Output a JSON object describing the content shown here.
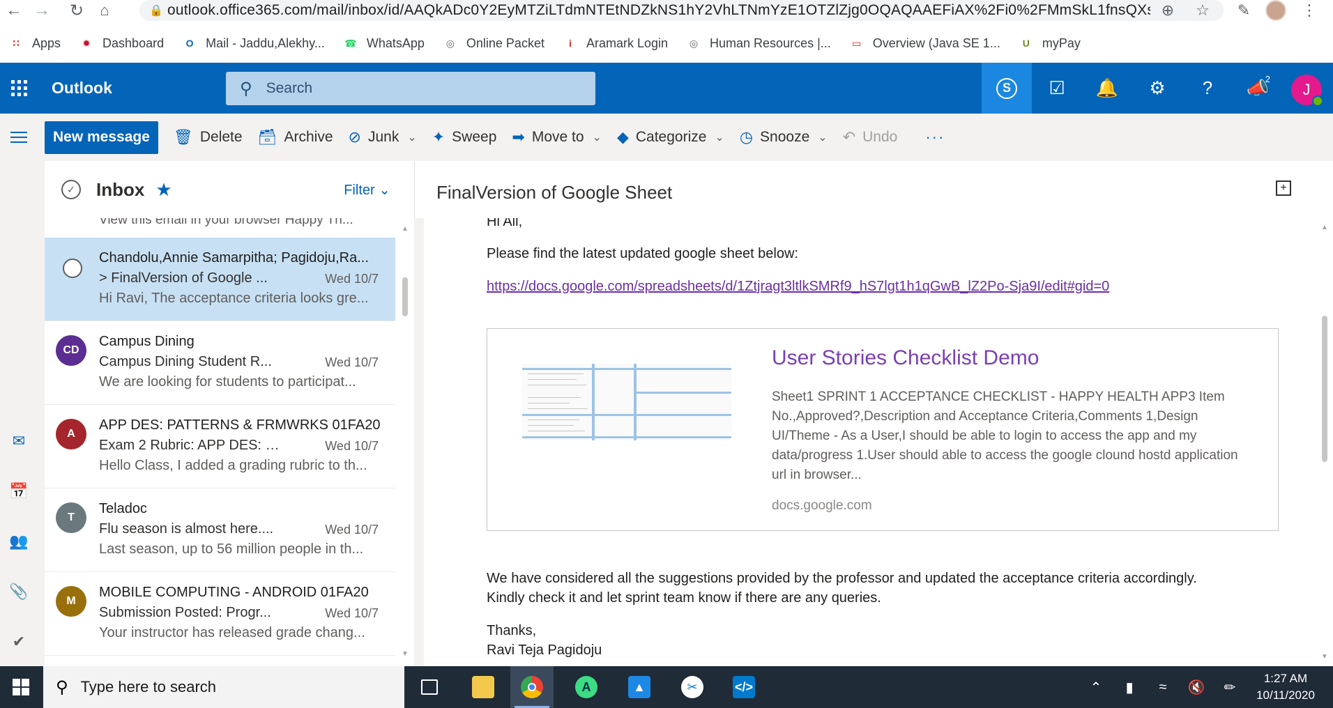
{
  "browser": {
    "url": "outlook.office365.com/mail/inbox/id/AAQkADc0Y2EyMTZiLTdmNTEtNDZkNS1hY2VhLTNmYzE1OTZlZjg0OQAQAAEFiAX%2Fi0%2FMmSkL1fnsQXs%3...",
    "bookmarks": [
      {
        "label": "Apps",
        "icon": "apps-grid-icon",
        "color": "#ea4335"
      },
      {
        "label": "Dashboard",
        "icon": "dashboard-icon",
        "color": "#c8102e"
      },
      {
        "label": "Mail - Jaddu,Alekhy...",
        "icon": "outlook-icon",
        "color": "#0364b8"
      },
      {
        "label": "WhatsApp",
        "icon": "whatsapp-icon",
        "color": "#25d366"
      },
      {
        "label": "Online Packet",
        "icon": "globe-icon",
        "color": "#5f6368"
      },
      {
        "label": "Aramark Login",
        "icon": "aramark-icon",
        "color": "#d52b1e"
      },
      {
        "label": "Human Resources |...",
        "icon": "globe-icon",
        "color": "#5f6368"
      },
      {
        "label": "Overview (Java SE 1...",
        "icon": "oracle-icon",
        "color": "#e5161b"
      },
      {
        "label": "myPay",
        "icon": "mypay-icon",
        "color": "#6f8d23"
      }
    ]
  },
  "outlook": {
    "brand": "Outlook",
    "search_placeholder": "Search",
    "new_message": "New message",
    "commands": {
      "delete": "Delete",
      "archive": "Archive",
      "junk": "Junk",
      "sweep": "Sweep",
      "move_to": "Move to",
      "categorize": "Categorize",
      "snooze": "Snooze",
      "undo": "Undo"
    },
    "header_icons": [
      "skype-icon",
      "todo-icon",
      "bell-icon",
      "gear-icon",
      "help-icon",
      "megaphone-icon"
    ],
    "megaphone_count": "2",
    "user_initial": "J",
    "accent": "#0364b8",
    "avatar_color": "#e3198d"
  },
  "inbox": {
    "title": "Inbox",
    "filter": "Filter",
    "truncated_preview": "View this email in your browser Happy Th...",
    "messages": [
      {
        "sender": "Chandolu,Annie Samarpitha; Pagidoju,Ra...",
        "subject": "> FinalVersion of Google ...",
        "date": "Wed 10/7",
        "preview": "Hi Ravi, The acceptance criteria looks gre...",
        "initials": "",
        "color": "#c7e0f4"
      },
      {
        "sender": "Campus Dining",
        "subject": "Campus Dining Student R...",
        "date": "Wed 10/7",
        "preview": "We are looking for students to participat...",
        "initials": "CD",
        "color": "#5c2e91"
      },
      {
        "sender": "APP DES: PATTERNS & FRMWRKS 01FA20",
        "subject": "Exam 2 Rubric: APP DES: P...",
        "date": "Wed 10/7",
        "preview": "Hello Class, I added a grading rubric to th...",
        "initials": "A",
        "color": "#a4262c"
      },
      {
        "sender": "Teladoc",
        "subject": "Flu season is almost here....",
        "date": "Wed 10/7",
        "preview": "Last season, up to 56 million people in th...",
        "initials": "T",
        "color": "#69797e"
      },
      {
        "sender": "MOBILE COMPUTING - ANDROID 01FA20",
        "subject": "Submission Posted: Progr...",
        "date": "Wed 10/7",
        "preview": "Your instructor has released grade chang...",
        "initials": "M",
        "color": "#986f0b"
      }
    ]
  },
  "reading": {
    "subject": "FinalVersion of Google Sheet",
    "greeting": "Hi All,",
    "line1": "Please find the latest updated google sheet below:",
    "link": "https://docs.google.com/spreadsheets/d/1Ztjragt3ltlkSMRf9_hS7lgt1h1qGwB_lZ2Po-Sja9I/edit#gid=0",
    "card": {
      "title": "User Stories Checklist Demo",
      "description": "Sheet1 SPRINT 1 ACCEPTANCE CHECKLIST - HAPPY HEALTH APP3 Item No.,Approved?,Description and Acceptance Criteria,Comments 1,Design UI/Theme - As a User,I should be able to login to access the app and my data/progress 1.User should able to access the google clound hostd application url in browser...",
      "source": "docs.google.com"
    },
    "para1": "We have considered all the suggestions provided by the professor and updated the acceptance criteria accordingly.",
    "para2": "Kindly check it and let sprint team know if there are any queries.",
    "thanks": "Thanks,",
    "signature": "Ravi Teja Pagidoju"
  },
  "taskbar": {
    "search_placeholder": "Type here to search",
    "apps": [
      "task-view-icon",
      "file-explorer-icon",
      "chrome-icon",
      "android-studio-icon",
      "photos-icon",
      "snip-icon",
      "vscode-icon"
    ],
    "time": "1:27 AM",
    "date": "10/11/2020"
  }
}
